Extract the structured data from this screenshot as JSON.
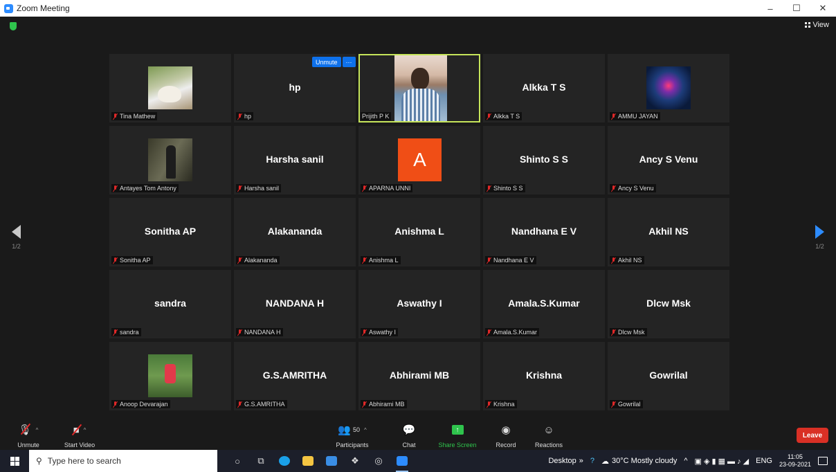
{
  "window": {
    "title": "Zoom Meeting",
    "controls": [
      "–",
      "☐",
      "✕"
    ]
  },
  "top": {
    "view_label": "View"
  },
  "pagination": {
    "left_label": "1/2",
    "right_label": "1/2"
  },
  "unmute_popup": {
    "unmute_label": "Unmute",
    "more_label": "···"
  },
  "participants": [
    {
      "label": "Tina Mathew",
      "display_name": "",
      "kind": "photo",
      "photo": "tina"
    },
    {
      "label": "hp",
      "display_name": "hp",
      "kind": "name"
    },
    {
      "label": "Prijith P K",
      "display_name": "",
      "kind": "video",
      "active": true
    },
    {
      "label": "Alkka T S",
      "display_name": "Alkka T S",
      "kind": "name"
    },
    {
      "label": "AMMU JAYAN",
      "display_name": "",
      "kind": "photo",
      "photo": "ammu"
    },
    {
      "label": "Antayes Tom Antony",
      "display_name": "",
      "kind": "photo",
      "photo": "antayes"
    },
    {
      "label": "Harsha sanil",
      "display_name": "Harsha sanil",
      "kind": "name"
    },
    {
      "label": "APARNA UNNI",
      "display_name": "A",
      "kind": "avatar",
      "avatar_color": "#f04e16"
    },
    {
      "label": "Shinto S S",
      "display_name": "Shinto S S",
      "kind": "name"
    },
    {
      "label": "Ancy S Venu",
      "display_name": "Ancy S Venu",
      "kind": "name"
    },
    {
      "label": "Sonitha AP",
      "display_name": "Sonitha AP",
      "kind": "name"
    },
    {
      "label": "Alakananda",
      "display_name": "Alakananda",
      "kind": "name"
    },
    {
      "label": "Anishma L",
      "display_name": "Anishma L",
      "kind": "name"
    },
    {
      "label": "Nandhana E V",
      "display_name": "Nandhana E V",
      "kind": "name"
    },
    {
      "label": "Akhil NS",
      "display_name": "Akhil NS",
      "kind": "name"
    },
    {
      "label": "sandra",
      "display_name": "sandra",
      "kind": "name"
    },
    {
      "label": "NANDANA H",
      "display_name": "NANDANA H",
      "kind": "name"
    },
    {
      "label": "Aswathy I",
      "display_name": "Aswathy I",
      "kind": "name"
    },
    {
      "label": "Amala.S.Kumar",
      "display_name": "Amala.S.Kumar",
      "kind": "name"
    },
    {
      "label": "Dlcw Msk",
      "display_name": "Dlcw Msk",
      "kind": "name"
    },
    {
      "label": "Anoop Devarajan",
      "display_name": "",
      "kind": "photo",
      "photo": "anoop"
    },
    {
      "label": "G.S.AMRITHA",
      "display_name": "G.S.AMRITHA",
      "kind": "name"
    },
    {
      "label": "Abhirami MB",
      "display_name": "Abhirami MB",
      "kind": "name"
    },
    {
      "label": "Krishna",
      "display_name": "Krishna",
      "kind": "name"
    },
    {
      "label": "Gowrilal",
      "display_name": "Gowrilal",
      "kind": "name"
    }
  ],
  "controls": {
    "unmute": "Unmute",
    "start_video": "Start Video",
    "participants": "Participants",
    "participants_count": "50",
    "chat": "Chat",
    "share_screen": "Share Screen",
    "record": "Record",
    "reactions": "Reactions",
    "leave": "Leave"
  },
  "colors": {
    "accent": "#2d8cff",
    "leave": "#d93025",
    "share": "#2fc44d",
    "active_speaker": "#c6e55a",
    "muted": "#e02828"
  },
  "taskbar": {
    "search_placeholder": "Type here to search",
    "desktop_label": "Desktop",
    "weather": "30°C  Mostly cloudy",
    "language": "ENG",
    "time": "11:05",
    "date": "23-09-2021"
  }
}
